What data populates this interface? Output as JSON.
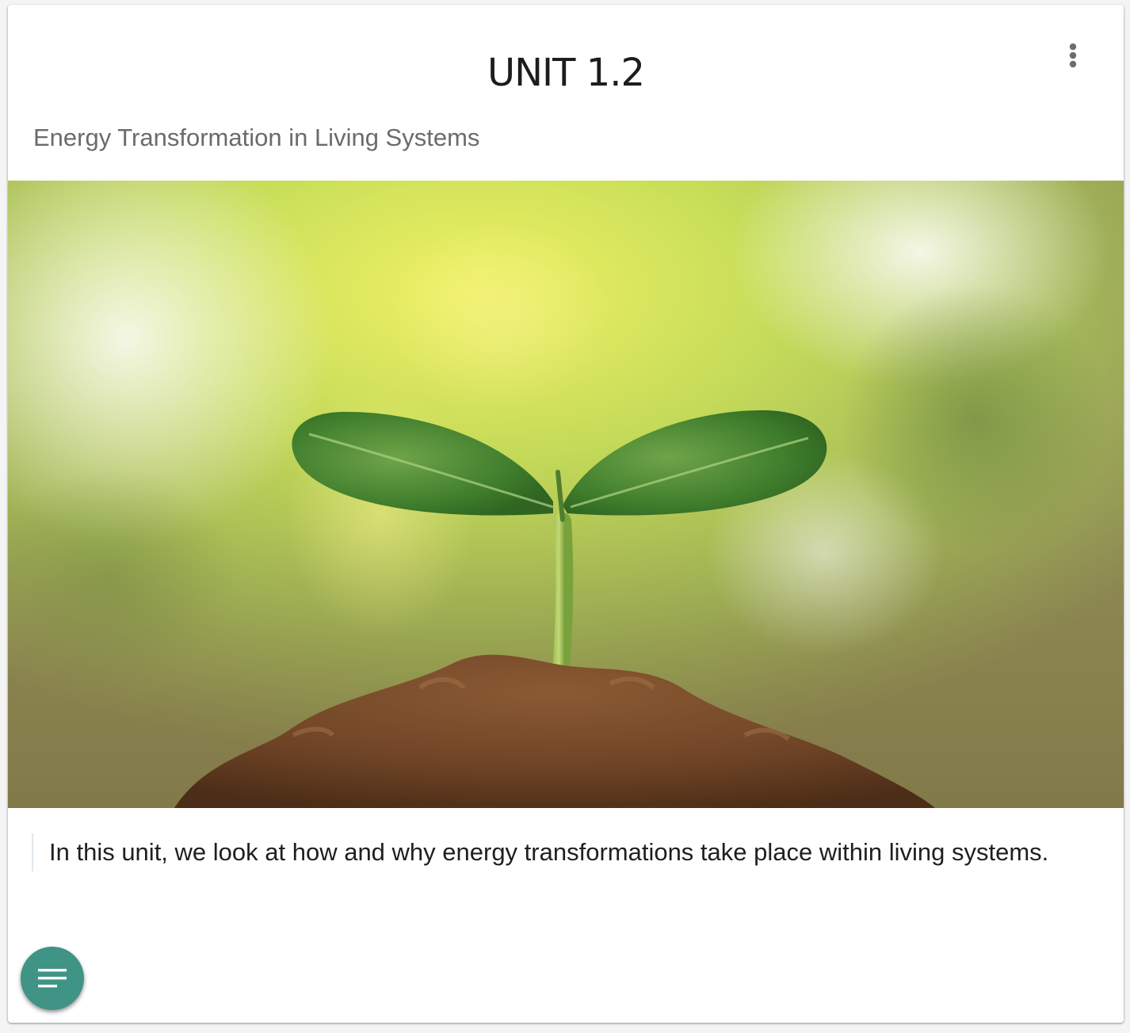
{
  "card": {
    "title": "UNIT 1.2",
    "subtitle": "Energy Transformation in Living Systems",
    "description": "In this unit, we look at how and why energy transformations take place within living systems.",
    "hero_image": "seedling-sprouting-from-soil",
    "menu_icon": "more-vert-icon"
  },
  "fab": {
    "icon": "menu-lines-icon",
    "color": "#3f9485"
  },
  "colors": {
    "title_text": "#1d1d1d",
    "subtitle_text": "#6b6b6b",
    "body_text": "#1f1f1f",
    "accent": "#3f9485"
  }
}
